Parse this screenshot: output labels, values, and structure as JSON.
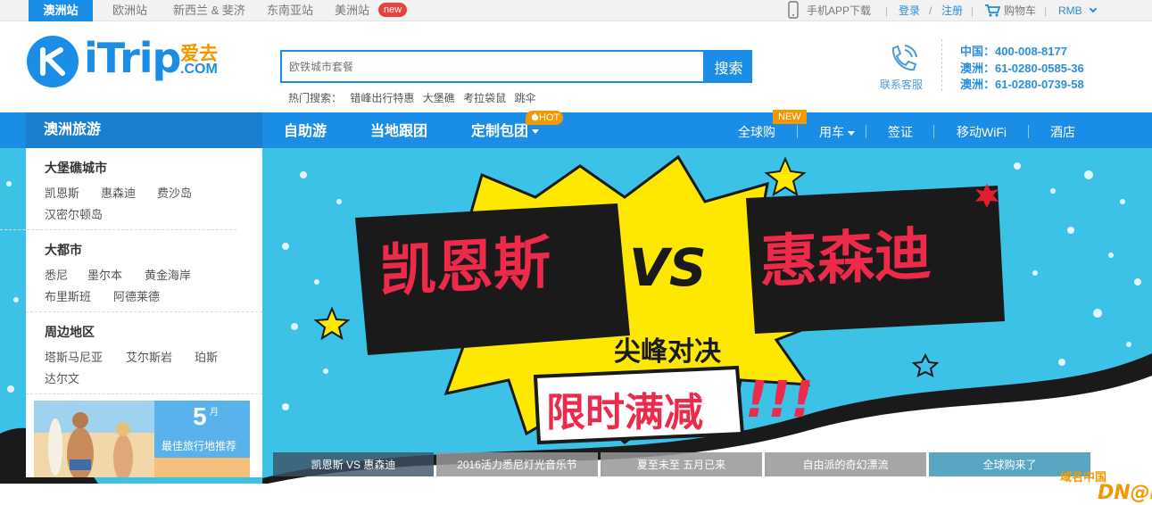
{
  "topbar": {
    "sites": [
      "澳洲站",
      "欧洲站",
      "新西兰 & 斐济",
      "东南亚站",
      "美洲站"
    ],
    "new_badge": "new",
    "app_download": "手机APP下载",
    "login": "登录",
    "slash": "/",
    "register": "注册",
    "cart": "购物车",
    "currency": "RMB"
  },
  "logo": {
    "word": "iTrip",
    "cn": "爱去",
    "com": ".COM"
  },
  "search": {
    "placeholder": "欧铁城市套餐",
    "button": "搜索",
    "hot_label": "热门搜索：",
    "hot_terms": [
      "错峰出行特惠",
      "大堡礁",
      "考拉袋鼠",
      "跳伞"
    ]
  },
  "customer_service": {
    "label": "联系客服",
    "phones": [
      "中国：400-008-8177",
      "澳洲：61-0280-0585-36",
      "澳洲：61-0280-0739-58"
    ]
  },
  "nav": {
    "side_title": "澳洲旅游",
    "main": [
      "自助游",
      "当地跟团",
      "定制包团"
    ],
    "hot_tag": "HOT",
    "new_tag": "NEW",
    "sub": [
      "全球购",
      "用车",
      "签证",
      "移动WiFi",
      "酒店"
    ]
  },
  "sidebar": {
    "groups": [
      {
        "title": "大堡礁城市",
        "cities": [
          "凯恩斯",
          "惠森迪",
          "费沙岛",
          "汉密尔顿岛"
        ]
      },
      {
        "title": "大都市",
        "cities": [
          "悉尼",
          "墨尔本",
          "黄金海岸",
          "布里斯班",
          "阿德莱德"
        ]
      },
      {
        "title": "周边地区",
        "cities": [
          "塔斯马尼亚",
          "艾尔斯岩",
          "珀斯",
          "达尔文"
        ]
      }
    ],
    "promo": {
      "month": "5",
      "month_unit": "月",
      "label": "最佳旅行地推荐"
    }
  },
  "banner": {
    "left": "凯恩斯",
    "vs": "VS",
    "right": "惠森迪",
    "subtitle": "尖峰对决",
    "promo": "限时满减",
    "exclaim": "!!!",
    "captions": [
      "凯恩斯 VS 惠森迪",
      "2016活力悉尼灯光音乐节",
      "夏至未至 五月已来",
      "自由派的奇幻漂流",
      "全球购来了"
    ],
    "colors": {
      "sky": "#3cc1e7",
      "yellow": "#ffe800",
      "red": "#ee2a4a"
    }
  },
  "watermark": {
    "cn": "域名中国",
    "en": "DN@ME"
  }
}
